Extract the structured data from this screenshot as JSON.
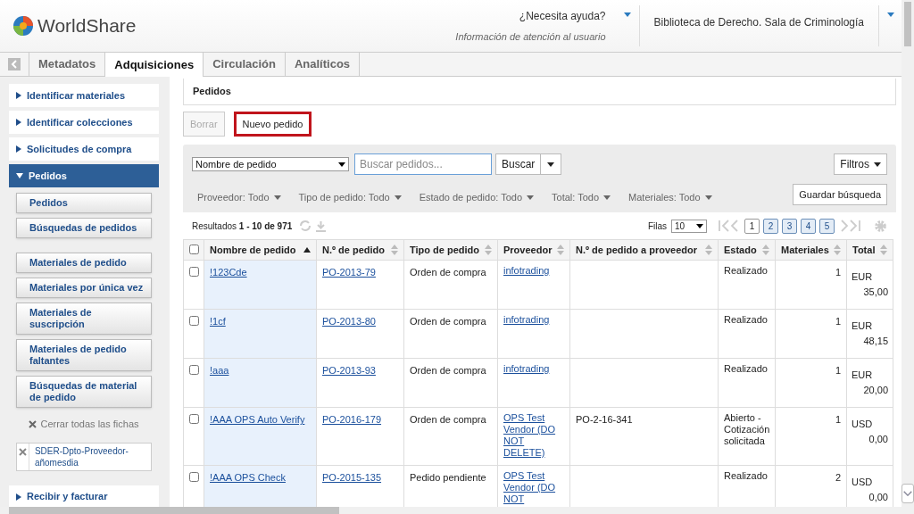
{
  "header": {
    "logo": "WorldShare",
    "help": "¿Necesita ayuda?",
    "help_sub": "Información de atención al usuario",
    "library": "Biblioteca de Derecho. Sala de Criminología"
  },
  "tabs": [
    {
      "label": "Metadatos",
      "selected": false
    },
    {
      "label": "Adquisiciones",
      "selected": true
    },
    {
      "label": "Circulación",
      "selected": false
    },
    {
      "label": "Analíticos",
      "selected": false
    }
  ],
  "sidebar": {
    "sections": [
      {
        "label": "Identificar materiales",
        "expanded": false
      },
      {
        "label": "Identificar colecciones",
        "expanded": false
      },
      {
        "label": "Solicitudes de compra",
        "expanded": false
      },
      {
        "label": "Pedidos",
        "expanded": true,
        "groups": [
          [
            "Pedidos",
            "Búsquedas de pedidos"
          ],
          [
            "Materiales de pedido",
            "Materiales por única vez",
            "Materiales de suscripción",
            "Materiales de pedido faltantes",
            "Búsquedas de material de pedido"
          ]
        ],
        "close_all": "Cerrar todas las fichas",
        "saved_tabs": [
          "SDER-Dpto-Proveedor-añomesdia"
        ]
      },
      {
        "label": "Recibir y facturar",
        "expanded": false
      }
    ]
  },
  "panel": {
    "title": "Pedidos"
  },
  "actions": [
    {
      "label": "Borrar",
      "disabled": true,
      "highlighted": false
    },
    {
      "label": "Nuevo pedido",
      "disabled": false,
      "highlighted": true
    }
  ],
  "search": {
    "scope": "Nombre de pedido",
    "placeholder": "Buscar pedidos...",
    "button": "Buscar",
    "filters": "Filtros",
    "save": "Guardar búsqueda"
  },
  "facets": [
    "Proveedor: Todo",
    "Tipo de pedido: Todo",
    "Estado de pedido: Todo",
    "Total: Todo",
    "Materiales: Todo"
  ],
  "results": {
    "summary": "Resultados **1 - 10 de 971**",
    "rows_label": "Filas",
    "rows_value": "10",
    "pages": [
      {
        "label": "1",
        "selected": true
      },
      {
        "label": "2",
        "selected": false
      },
      {
        "label": "3",
        "selected": false
      },
      {
        "label": "4",
        "selected": false
      },
      {
        "label": "5",
        "selected": false
      }
    ]
  },
  "table": {
    "all_checked": false,
    "columns": [
      {
        "label": "Nombre de pedido",
        "sorted": true
      },
      {
        "label": "N.º de pedido",
        "sorted": false
      },
      {
        "label": "Tipo de pedido",
        "sorted": false
      },
      {
        "label": "Proveedor",
        "sorted": false
      },
      {
        "label": "N.º de pedido a proveedor",
        "sorted": false
      },
      {
        "label": "Estado",
        "sorted": false
      },
      {
        "label": "Materiales",
        "sorted": false
      },
      {
        "label": "Total",
        "sorted": false
      }
    ],
    "rows": [
      {
        "checked": false,
        "name": "!123Cde",
        "po": "PO-2013-79",
        "type": "Orden de compra",
        "vendor": "infotrading",
        "vendor_po": "",
        "status": "Realizado",
        "items": "1",
        "currency": "EUR",
        "amount": "35,00"
      },
      {
        "checked": false,
        "name": "!1cf",
        "po": "PO-2013-80",
        "type": "Orden de compra",
        "vendor": "infotrading",
        "vendor_po": "",
        "status": "Realizado",
        "items": "1",
        "currency": "EUR",
        "amount": "48,15"
      },
      {
        "checked": false,
        "name": "!aaa",
        "po": "PO-2013-93",
        "type": "Orden de compra",
        "vendor": "infotrading",
        "vendor_po": "",
        "status": "Realizado",
        "items": "1",
        "currency": "EUR",
        "amount": "20,00"
      },
      {
        "checked": false,
        "name": "!AAA OPS Auto Verify",
        "po": "PO-2016-179",
        "type": "Orden de compra",
        "vendor": "OPS Test Vendor (DO NOT DELETE)",
        "vendor_po": "PO-2-16-341",
        "status": "Abierto - Cotización solicitada",
        "items": "1",
        "currency": "USD",
        "amount": "0,00"
      },
      {
        "checked": false,
        "name": "!AAA OPS Check",
        "po": "PO-2015-135",
        "type": "Pedido pendiente",
        "vendor": "OPS Test Vendor (DO NOT",
        "vendor_po": "",
        "status": "Realizado",
        "items": "2",
        "currency": "USD",
        "amount": "0,00"
      }
    ]
  }
}
